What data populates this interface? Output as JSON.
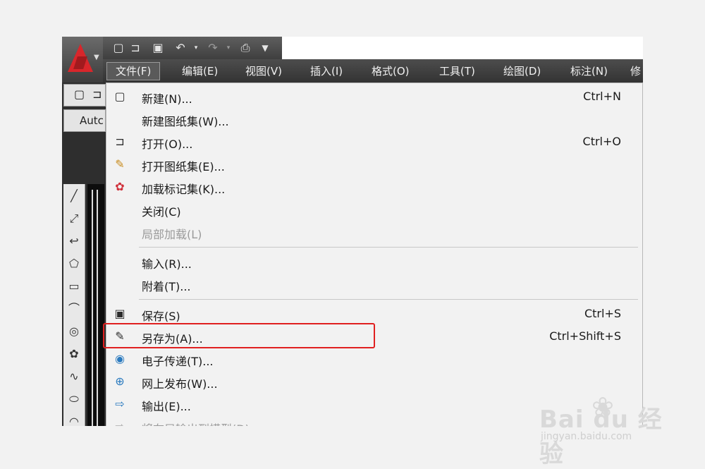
{
  "qat": {
    "icons": [
      "new-file-icon",
      "open-folder-icon",
      "save-icon",
      "undo-icon",
      "redo-icon",
      "print-icon"
    ]
  },
  "menubar": {
    "items": [
      "文件(F)",
      "编辑(E)",
      "视图(V)",
      "插入(I)",
      "格式(O)",
      "工具(T)",
      "绘图(D)",
      "标注(N)",
      "修"
    ]
  },
  "left_toolbar": {
    "workspace_text": "Autc"
  },
  "file_menu": {
    "items": [
      {
        "label": "新建(N)...",
        "shortcut": "Ctrl+N",
        "icon": "new-file-icon"
      },
      {
        "label": "新建图纸集(W)...",
        "shortcut": "",
        "icon": ""
      },
      {
        "label": "打开(O)...",
        "shortcut": "Ctrl+O",
        "icon": "open-folder-icon"
      },
      {
        "label": "打开图纸集(E)...",
        "shortcut": "",
        "icon": "open-sheetset-icon"
      },
      {
        "label": "加载标记集(K)...",
        "shortcut": "",
        "icon": "markup-set-icon"
      },
      {
        "label": "关闭(C)",
        "shortcut": "",
        "icon": ""
      },
      {
        "label": "局部加载(L)",
        "shortcut": "",
        "icon": "",
        "disabled": true
      },
      {
        "label": "输入(R)...",
        "shortcut": "",
        "icon": ""
      },
      {
        "label": "附着(T)...",
        "shortcut": "",
        "icon": ""
      },
      {
        "label": "保存(S)",
        "shortcut": "Ctrl+S",
        "icon": "save-icon"
      },
      {
        "label": "另存为(A)...",
        "shortcut": "Ctrl+Shift+S",
        "icon": "save-as-icon"
      },
      {
        "label": "电子传递(T)...",
        "shortcut": "",
        "icon": "etransmit-icon"
      },
      {
        "label": "网上发布(W)...",
        "shortcut": "",
        "icon": "publish-web-icon"
      },
      {
        "label": "输出(E)...",
        "shortcut": "",
        "icon": "export-icon"
      },
      {
        "label": "将布局输出到模型(D)...",
        "shortcut": "",
        "icon": "export-layout-icon",
        "disabled": true
      }
    ]
  },
  "watermark": {
    "logo": "Bai du 经验",
    "url": "jingyan.baidu.com"
  },
  "colors": {
    "highlight": "#e02020",
    "menubar": "#3c3c3c",
    "logo": "#d8262b"
  }
}
